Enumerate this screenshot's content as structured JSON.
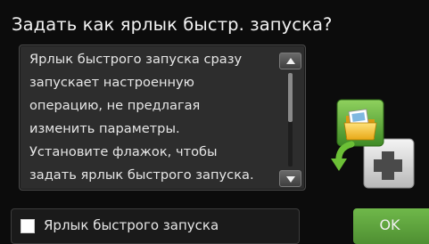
{
  "dialog": {
    "title": "Задать как ярлык быстр. запуска?",
    "message_lines": [
      "Ярлык быстрого запуска сразу",
      "запускает настроенную",
      "операцию, не предлагая",
      "изменить параметры.",
      "Установите флажок, чтобы",
      "задать ярлык быстрого запуска."
    ],
    "scroll_up_icon": "triangle-up-icon",
    "scroll_down_icon": "triangle-down-icon",
    "graphic_icon": "folder-shortcut-add-icon"
  },
  "footer": {
    "checkbox_label": "Ярлык быстрого запуска",
    "checkbox_checked": false,
    "ok_label": "OK"
  },
  "colors": {
    "background": "#0c0c0c",
    "message_box": "#2d2d2d",
    "ok_green": "#5fa83e"
  }
}
